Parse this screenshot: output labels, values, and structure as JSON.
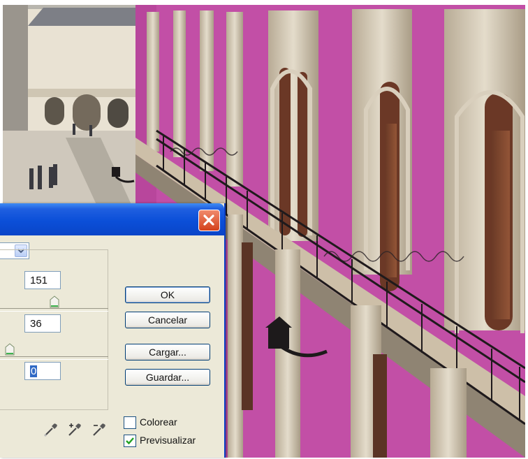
{
  "dialog": {
    "title_bar": {
      "close_icon": "close-icon"
    },
    "fields": {
      "value_1": "151",
      "value_2": "36",
      "value_3": "0"
    },
    "sliders": {
      "slider_1_level": 0.5,
      "slider_2_level": 0.1
    },
    "buttons": {
      "ok": "OK",
      "cancel": "Cancelar",
      "load": "Cargar...",
      "save": "Guardar..."
    },
    "checkboxes": {
      "colorize": {
        "label": "Colorear",
        "checked": false
      },
      "preview": {
        "label": "Previsualizar",
        "checked": true
      }
    },
    "eyedroppers": [
      "eyedropper-icon",
      "eyedropper-plus-icon",
      "eyedropper-minus-icon"
    ]
  },
  "colors": {
    "facade_magenta": "#c24fa6",
    "titlebar_blue": "#0b4fd8",
    "dialog_face": "#ece9d8",
    "close_red": "#d4421c"
  }
}
